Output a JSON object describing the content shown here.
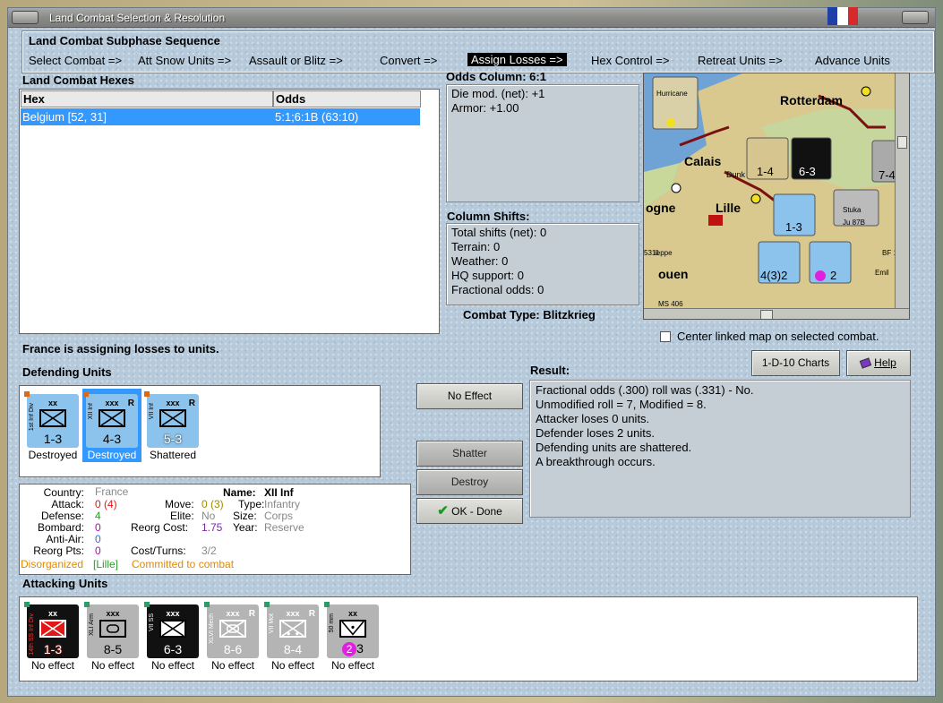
{
  "window": {
    "title": "Land Combat Selection & Resolution"
  },
  "sequence": {
    "title": "Land Combat Subphase Sequence",
    "steps": [
      "Select Combat =>",
      "Att Snow Units =>",
      "Assault or Blitz =>",
      "Convert =>",
      "Assign Losses =>",
      "Hex Control =>",
      "Retreat Units =>",
      "Advance Units"
    ],
    "active_index": 4
  },
  "hexes": {
    "title": "Land Combat Hexes",
    "col_hex": "Hex",
    "col_odds": "Odds",
    "rows": [
      {
        "hex": "Belgium [52, 31]",
        "odds": "5:1;6:1B (63:10)"
      }
    ]
  },
  "odds": {
    "title": "Odds Column: 6:1",
    "lines": [
      "Die mod. (net): +1",
      "Armor: +1.00"
    ]
  },
  "shifts": {
    "title": "Column Shifts:",
    "lines": [
      "Total shifts (net): 0",
      "Terrain: 0",
      "Weather: 0",
      "HQ support: 0",
      "Fractional odds: 0"
    ]
  },
  "combat_type": "Combat Type:  Blitzkrieg",
  "map": {
    "labels": [
      "Rotterdam",
      "Calais",
      "Lille",
      "ogne",
      "ouen",
      "Dunk",
      "Hurricane",
      "Ju 87B",
      "Stuka",
      "Emil",
      "BF 10",
      "MS 406",
      "ieppe",
      "5311"
    ],
    "counters": [
      "1-4",
      "6-3",
      "1-3",
      "4(3)2",
      "2",
      "7-4"
    ]
  },
  "center_link": {
    "label": "Center linked map on selected combat.",
    "checked": false
  },
  "status_msg": "France is assigning losses to units.",
  "defending": {
    "title": "Defending Units",
    "units": [
      {
        "side": "1st Inf Div",
        "size": "xx",
        "str": "1-3",
        "status": "Destroyed",
        "selected": false,
        "r": ""
      },
      {
        "side": "XII Inf",
        "size": "xxx",
        "str": "4-3",
        "status": "Destroyed",
        "selected": true,
        "r": "R"
      },
      {
        "side": "VII Inf",
        "size": "xxx",
        "str": "5-3",
        "status": "Shattered",
        "selected": false,
        "r": "R"
      }
    ]
  },
  "info": {
    "country_lbl": "Country:",
    "country": "France",
    "attack_lbl": "Attack:",
    "attack": "0 (4)",
    "defense_lbl": "Defense:",
    "defense": "4",
    "bombard_lbl": "Bombard:",
    "bombard": "0",
    "antiair_lbl": "Anti-Air:",
    "antiair": "0",
    "reorg_lbl": "Reorg Pts:",
    "reorg": "0",
    "name_lbl": "Name:",
    "name": "XII Inf",
    "move_lbl": "Move:",
    "move": "0 (3)",
    "type_lbl": "Type:",
    "type": "Infantry",
    "elite_lbl": "Elite:",
    "elite": "No",
    "size_lbl": "Size:",
    "size": "Corps",
    "reorgcost_lbl": "Reorg Cost:",
    "reorgcost": "1.75",
    "year_lbl": "Year:",
    "year": "Reserve",
    "costturns_lbl": "Cost/Turns:",
    "costturns": "3/2",
    "disorg": "Disorganized",
    "location": "[Lille]",
    "committed": "Committed to combat"
  },
  "result": {
    "title": "Result:",
    "lines": [
      "Fractional odds (.300) roll was (.331)  - No.",
      "Unmodified roll = 7, Modified = 8.",
      "Attacker loses 0 units.",
      "Defender loses 2 units.",
      "Defending units are shattered.",
      "A breakthrough occurs."
    ]
  },
  "buttons": {
    "no_effect": "No Effect",
    "shatter": "Shatter",
    "destroy": "Destroy",
    "ok_done": "OK - Done",
    "charts": "1-D-10 Charts",
    "help": "Help"
  },
  "attacking": {
    "title": "Attacking Units",
    "units": [
      {
        "side": "14th SS Inf Div",
        "size": "xx",
        "str": "1-3",
        "status": "No effect",
        "style": "red",
        "r": ""
      },
      {
        "side": "XLI Arm",
        "size": "xxx",
        "str": "8-5",
        "status": "No effect",
        "style": "grey",
        "r": ""
      },
      {
        "side": "VII SS",
        "size": "xxx",
        "str": "6-3",
        "status": "No effect",
        "style": "black",
        "r": ""
      },
      {
        "side": "XLVI Mech",
        "size": "xxx",
        "str": "8-6",
        "status": "No effect",
        "style": "grey",
        "r": "R"
      },
      {
        "side": "VII Mot",
        "size": "xxx",
        "str": "8-4",
        "status": "No effect",
        "style": "grey",
        "r": "R"
      },
      {
        "side": "50 mm",
        "size": "xx",
        "str": "3",
        "badge": "2",
        "status": "No effect",
        "style": "grey",
        "r": ""
      }
    ]
  },
  "colors": {
    "accent": "#3399ff",
    "attack_red": "#e01818",
    "defense_green": "#2a9d2a",
    "bombard_magenta": "#c000c0",
    "disorg_orange": "#e08a00"
  }
}
